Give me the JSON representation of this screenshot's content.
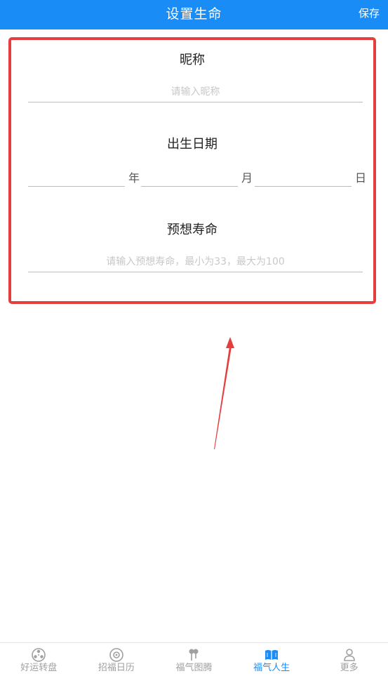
{
  "header": {
    "title": "设置生命",
    "save_label": "保存"
  },
  "form": {
    "nickname": {
      "label": "昵称",
      "placeholder": "请输入昵称",
      "value": ""
    },
    "birth_date": {
      "label": "出生日期",
      "year_unit": "年",
      "month_unit": "月",
      "day_unit": "日",
      "year_value": "",
      "month_value": "",
      "day_value": ""
    },
    "lifespan": {
      "label": "预想寿命",
      "placeholder": "请输入预想寿命，最小为33，最大为100",
      "value": ""
    }
  },
  "annotation": {
    "border_color": "#e53e3e",
    "arrow_color": "#e53e3e"
  },
  "tabbar": {
    "active_color": "#1a8cf5",
    "inactive_color": "#a0a0a0",
    "items": [
      {
        "label": "好运转盘",
        "icon": "wheel-icon",
        "active": false
      },
      {
        "label": "招福日历",
        "icon": "calendar-icon",
        "active": false
      },
      {
        "label": "福气图腾",
        "icon": "totem-icon",
        "active": false
      },
      {
        "label": "福气人生",
        "icon": "book-icon",
        "active": true
      },
      {
        "label": "更多",
        "icon": "person-icon",
        "active": false
      }
    ]
  }
}
